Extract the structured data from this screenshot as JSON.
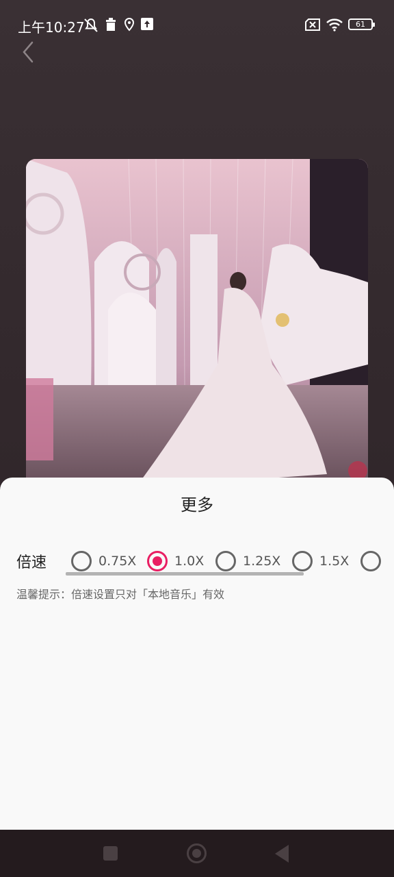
{
  "status_bar": {
    "time": "上午10:27",
    "battery": "61",
    "icons": [
      "mute-icon",
      "trash-icon",
      "location-icon",
      "upload-icon",
      "no-sim-icon",
      "wifi-icon",
      "battery-icon"
    ]
  },
  "header": {
    "back_icon": "chevron-left-icon"
  },
  "sheet": {
    "title": "更多",
    "speed_label": "倍速",
    "options": [
      {
        "label": "0.75X",
        "checked": false
      },
      {
        "label": "1.0X",
        "checked": true
      },
      {
        "label": "1.25X",
        "checked": false
      },
      {
        "label": "1.5X",
        "checked": false
      },
      {
        "label": "",
        "checked": false
      }
    ],
    "hint": "温馨提示：倍速设置只对「本地音乐」有效"
  },
  "colors": {
    "accent": "#e91e63",
    "sheet_bg": "#f9f9f9"
  },
  "nav_bar": {
    "icons": [
      "recents-icon",
      "home-icon",
      "back-icon"
    ]
  }
}
